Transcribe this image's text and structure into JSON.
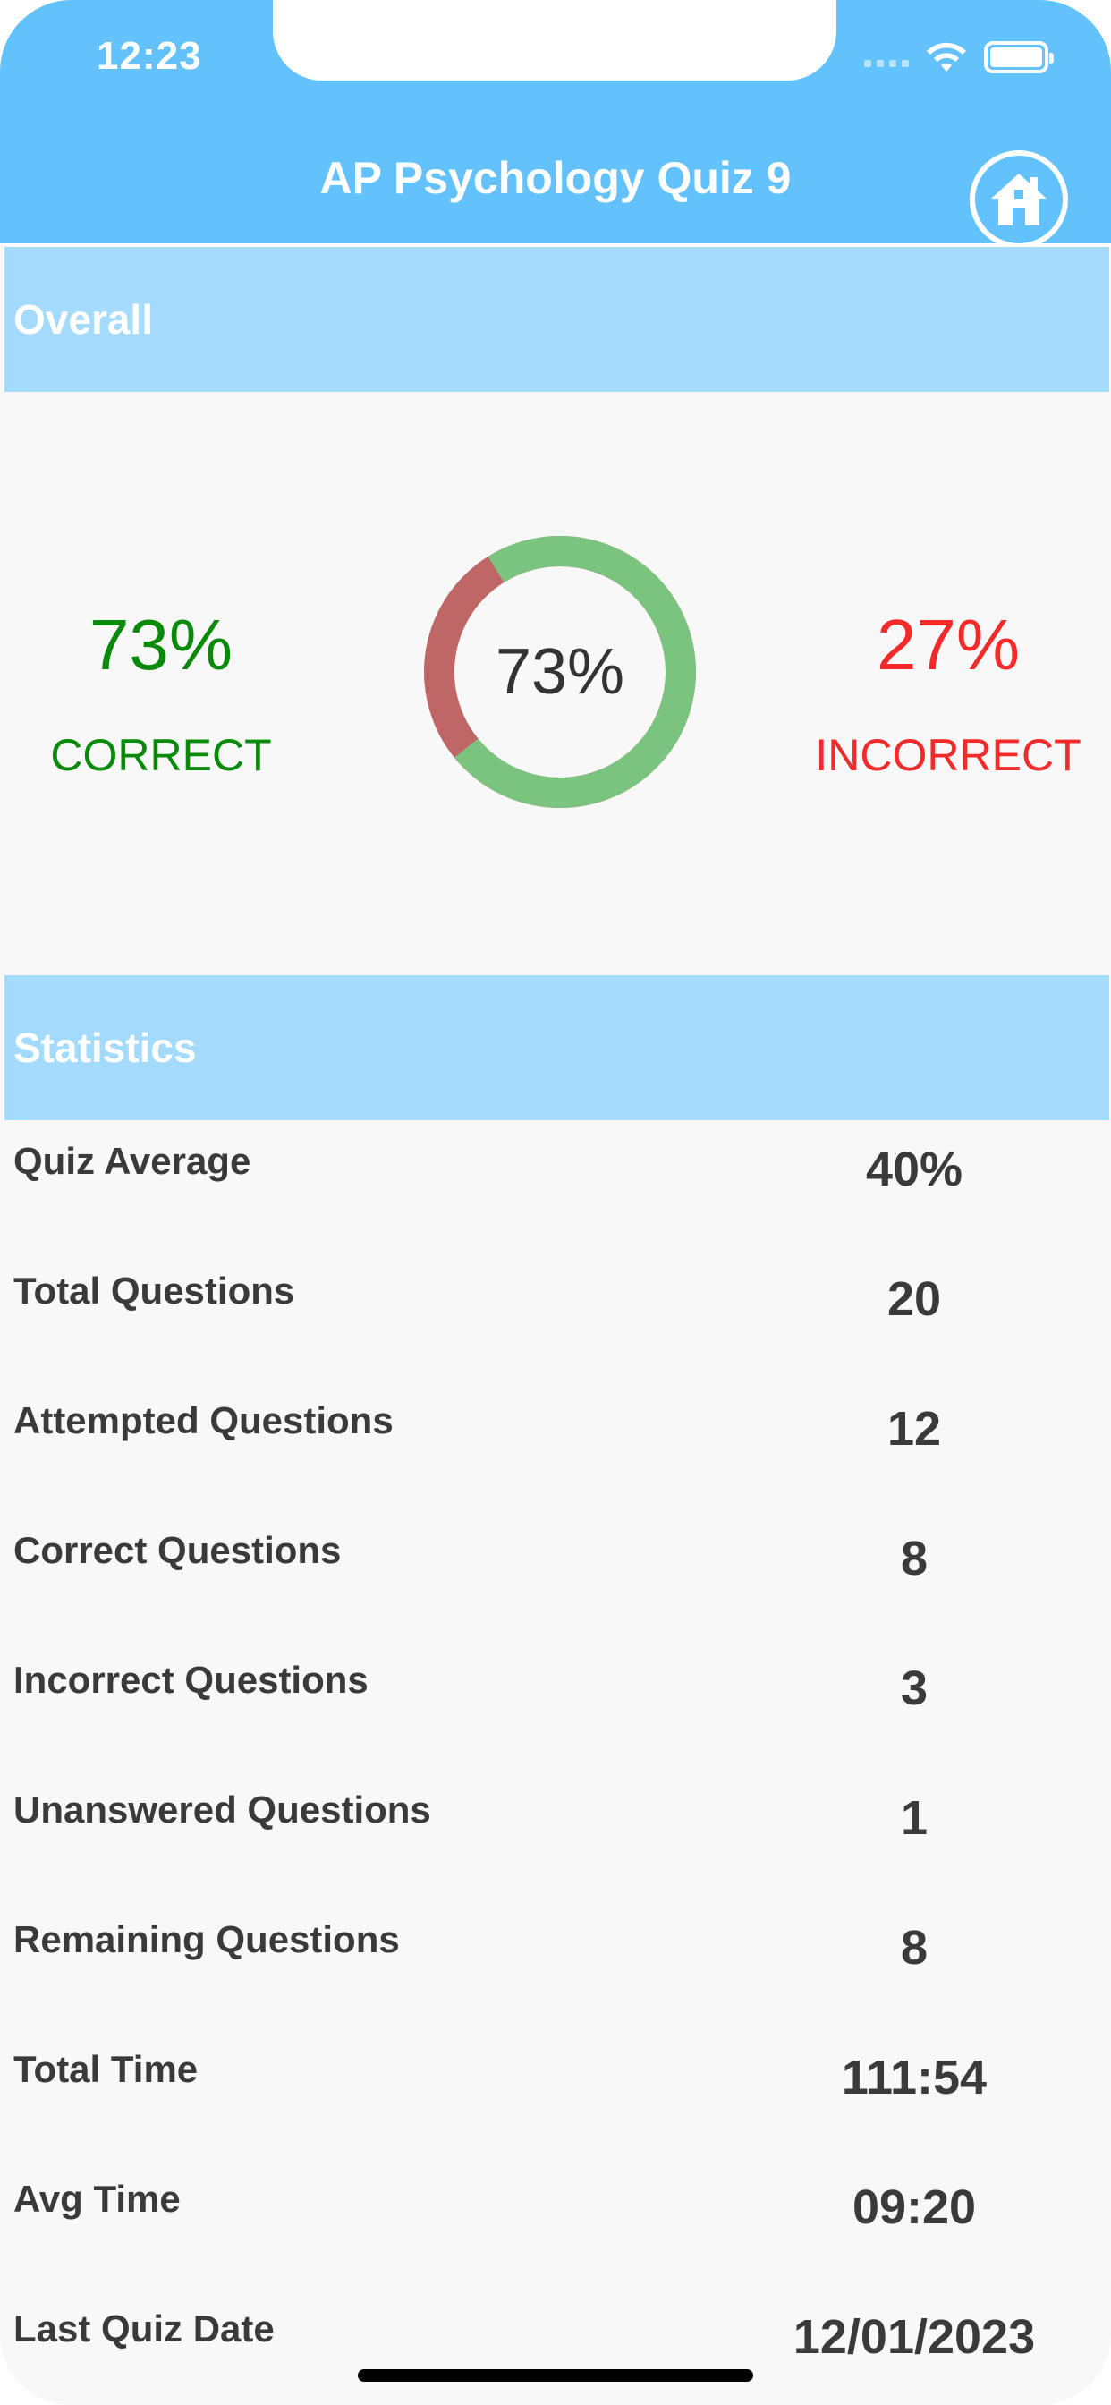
{
  "status_bar": {
    "time": "12:23"
  },
  "nav": {
    "title": "AP Psychology Quiz 9"
  },
  "overall": {
    "heading": "Overall",
    "correct_pct": "73%",
    "correct_label": "CORRECT",
    "incorrect_pct": "27%",
    "incorrect_label": "INCORRECT",
    "donut_text": "73%",
    "correct_fraction": 0.73,
    "colors": {
      "correct": "#7bc47f",
      "incorrect": "#bf6666",
      "correct_text": "#0a8a0a",
      "incorrect_text": "#f32a2a"
    }
  },
  "statistics": {
    "heading": "Statistics",
    "rows": [
      {
        "label": "Quiz Average",
        "value": "40%"
      },
      {
        "label": "Total Questions",
        "value": "20"
      },
      {
        "label": "Attempted Questions",
        "value": "12"
      },
      {
        "label": "Correct Questions",
        "value": "8"
      },
      {
        "label": "Incorrect Questions",
        "value": "3"
      },
      {
        "label": "Unanswered Questions",
        "value": "1"
      },
      {
        "label": "Remaining Questions",
        "value": "8"
      },
      {
        "label": "Total Time",
        "value": "111:54"
      },
      {
        "label": "Avg Time",
        "value": "09:20"
      },
      {
        "label": "Last Quiz Date",
        "value": "12/01/2023"
      }
    ]
  },
  "theme": {
    "header": "#63c2fb",
    "band": "#a4dbfc"
  }
}
